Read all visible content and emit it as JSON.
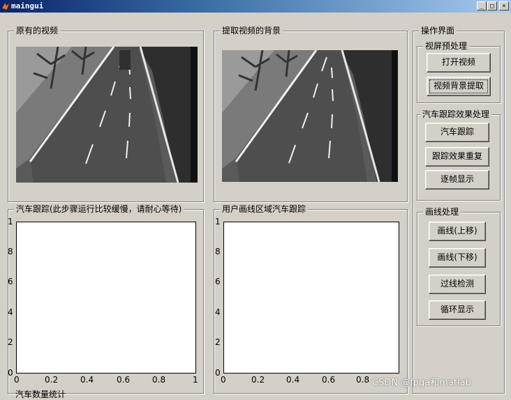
{
  "window": {
    "title": "maingui",
    "min_label": "_",
    "max_label": "□",
    "close_label": "×"
  },
  "panels": {
    "original": {
      "title": "原有的视频"
    },
    "background": {
      "title": "提取视频的背景"
    },
    "tracking": {
      "title": "汽车跟踪(此步骤运行比较缓慢，请耐心等待)"
    },
    "user_region": {
      "title": "用户画线区域汽车跟踪"
    },
    "operations": {
      "title": "操作界面"
    }
  },
  "preprocess": {
    "title": "视屏预处理",
    "open_video": "打开视频",
    "extract_bg": "视频背景提取"
  },
  "tracking_effect": {
    "title": "汽车跟踪效果处理",
    "car_track": "汽车跟踪",
    "repeat": "跟踪效果重复",
    "frame_by_frame": "逐帧显示"
  },
  "line_processing": {
    "title": "画线处理",
    "line_up": "画线(上移)",
    "line_down": "画线(下移)",
    "cross_detect": "过线检测",
    "loop_display": "循环显示"
  },
  "axes": {
    "y_ticks": [
      "1",
      "8",
      "6",
      "4",
      "2",
      "0"
    ],
    "x_ticks": [
      "0",
      "0.2",
      "0.4",
      "0.6",
      "0.8",
      "1"
    ]
  },
  "bottom_label": "汽车数量统计",
  "watermark": "CSDN @fpga和matlab"
}
